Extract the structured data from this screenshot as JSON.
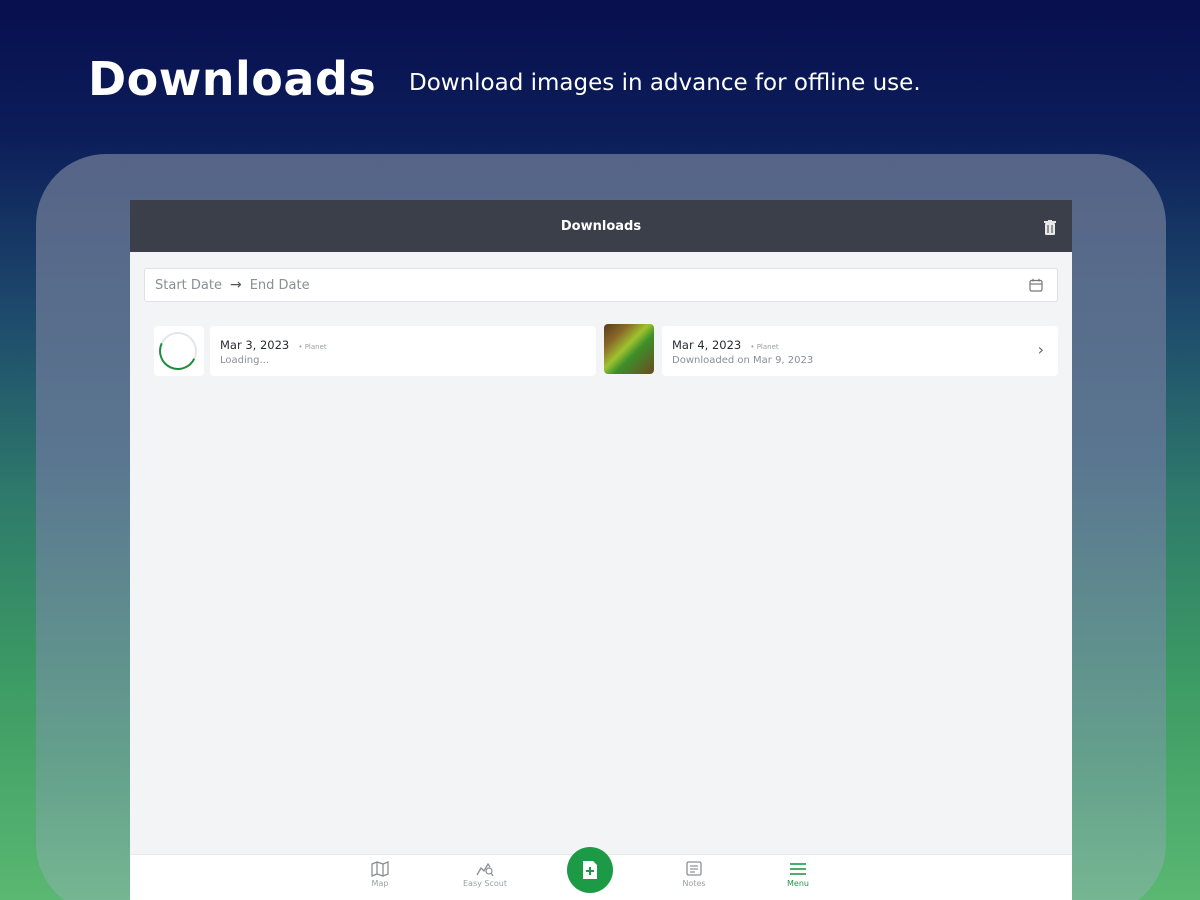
{
  "promo": {
    "title": "Downloads",
    "subtitle": "Download images in advance for offline use."
  },
  "header": {
    "title": "Downloads",
    "trash_icon": "trash-icon"
  },
  "date_range": {
    "start": "Start Date",
    "arrow": "→",
    "end": "End Date",
    "icon": "calendar-icon"
  },
  "downloads": [
    {
      "date": "Mar 3, 2023",
      "tag": "• Planet",
      "status": "Loading..."
    },
    {
      "date": "Mar 4, 2023",
      "tag": "• Planet",
      "status": "Downloaded on Mar 9, 2023"
    }
  ],
  "nav": {
    "items": [
      {
        "label": "Map",
        "icon": "map-icon"
      },
      {
        "label": "Easy Scout",
        "icon": "scout-icon"
      },
      {
        "label": "Notes",
        "icon": "notes-icon"
      },
      {
        "label": "Menu",
        "icon": "menu-icon"
      }
    ],
    "fab_icon": "add-note-icon"
  },
  "colors": {
    "accent": "#1c9a46",
    "header_bg": "#3b3f4a"
  }
}
